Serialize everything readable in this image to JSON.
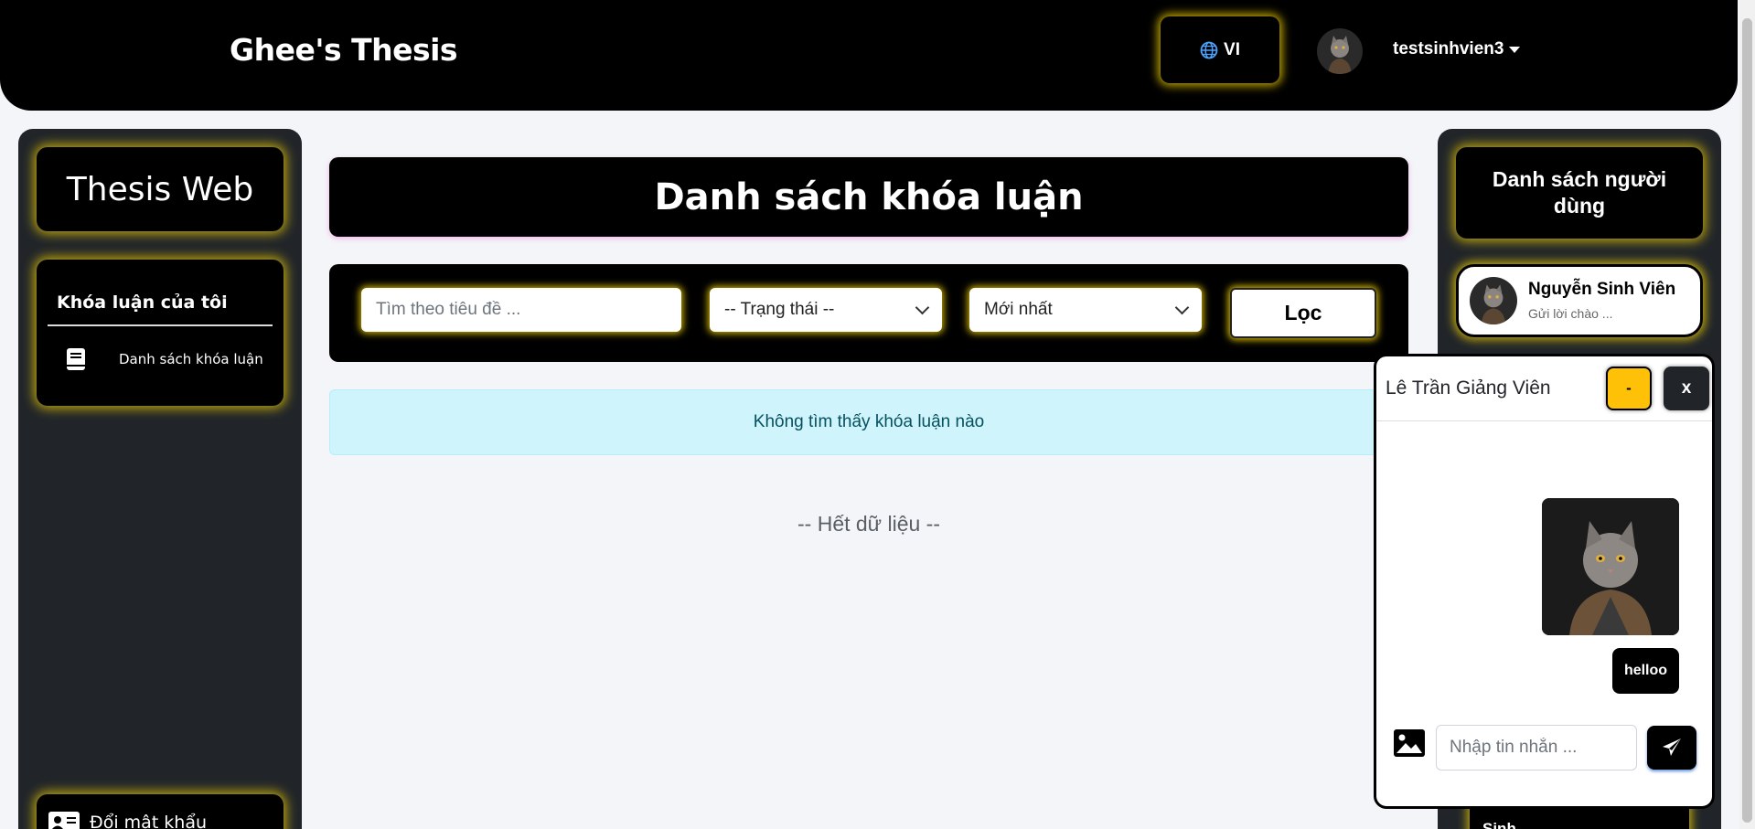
{
  "header": {
    "brand": "Ghee's Thesis",
    "language_label": "VI",
    "username": "testsinhvien3",
    "icons": {
      "language": "globe-icon",
      "user_menu": "caret-down-icon"
    }
  },
  "left_sidebar": {
    "title": "Thesis Web",
    "section_heading": "Khóa luận của tôi",
    "items": [
      {
        "label": "Danh sách khóa luận",
        "icon": "book-icon"
      }
    ],
    "bottom_item": {
      "label": "Đổi mật khẩu",
      "icon": "id-card-icon"
    }
  },
  "main": {
    "page_title": "Danh sách khóa luận",
    "filters": {
      "search_placeholder": "Tìm theo tiêu đề ...",
      "status_selected": "-- Trạng thái --",
      "sort_selected": "Mới nhất",
      "filter_button": "Lọc"
    },
    "empty_message": "Không tìm thấy khóa luận nào",
    "end_of_data": "-- Hết dữ liệu --"
  },
  "right_sidebar": {
    "title": "Danh sách người dùng",
    "users": [
      {
        "name": "Nguyễn Sinh Viên",
        "last_message": "Gửi lời chào ..."
      }
    ],
    "partial_item": "Sinh..."
  },
  "chat": {
    "partner_name": "Lê Trần Giảng Viên",
    "minimize_label": "-",
    "close_label": "x",
    "messages": [
      {
        "type": "image",
        "alt": "cat-avatar-image"
      },
      {
        "type": "text",
        "text": "helloo"
      }
    ],
    "input_placeholder": "Nhập tin nhắn ...",
    "icons": {
      "attach": "image-icon",
      "send": "paper-plane-icon"
    }
  },
  "colors": {
    "accent_glow": "#ffdc00",
    "minimize": "#ffc107",
    "info_bg": "#cff4fc",
    "info_text": "#055160"
  }
}
